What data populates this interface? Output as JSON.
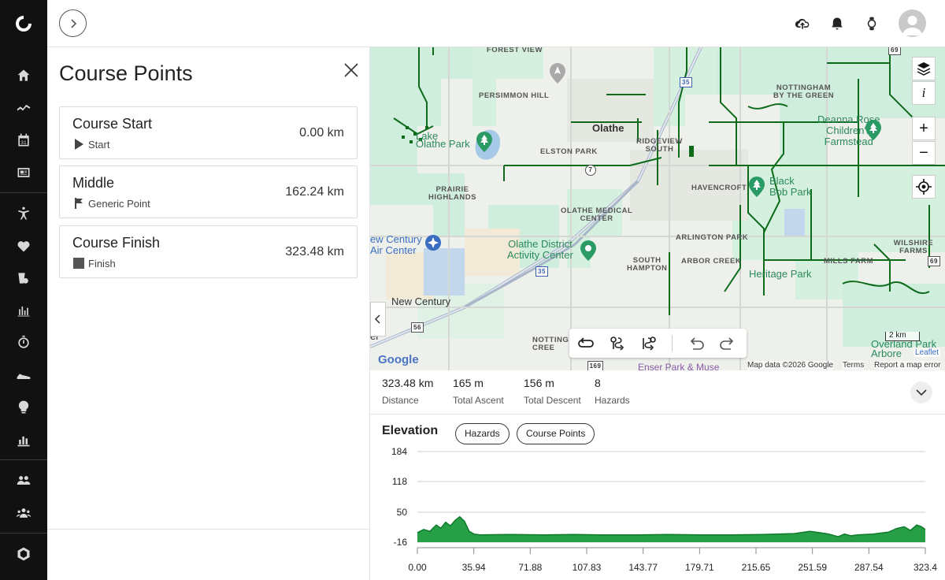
{
  "nav": {
    "items": [
      "home-icon",
      "activity-icon",
      "calendar-icon",
      "news-icon",
      "fitness-icon",
      "heart-icon",
      "nutrition-icon",
      "stats-icon",
      "stopwatch-icon",
      "shoe-icon",
      "insights-icon",
      "reports-icon",
      "connections-icon",
      "groups-icon",
      "badge-icon"
    ],
    "calendar_day": "31"
  },
  "panel": {
    "title": "Course Points",
    "points": [
      {
        "name": "Course Start",
        "type": "Start",
        "distance": "0.00 km"
      },
      {
        "name": "Middle",
        "type": "Generic Point",
        "distance": "162.24 km"
      },
      {
        "name": "Course Finish",
        "type": "Finish",
        "distance": "323.48 km"
      }
    ]
  },
  "map": {
    "labels": {
      "forest_view": "FOREST VIEW",
      "persimmon_hill": "PERSIMMON HILL",
      "nottingham": "NOTTINGHAM\nBY THE GREEN",
      "olathe": "Olathe",
      "lake_olathe": "Lake\nOlathe Park",
      "elston_park": "ELSTON PARK",
      "ridgeview_south": "RIDGEVIEW\nSOUTH",
      "deanna_rose": "Deanna Rose\nChildren's\nFarmstead",
      "prairie_highlands": "PRAIRIE\nHIGHLANDS",
      "havencroft": "HAVENCROFT",
      "black_bob": "Black\nBob Park",
      "olathe_medical": "OLATHE MEDICAL\nCENTER",
      "new_century_air": "ew Century\nAir Center",
      "olathe_district": "Olathe District\nActivity Center",
      "arlington_park": "ARLINGTON PARK",
      "wilshire_farms": "WILSHIRE FARMS",
      "south_hampton": "SOUTH\nHAMPTON",
      "arbor_creek": "ARBOR CREEK",
      "mills_farm": "MILLS FARM",
      "heritage_park": "Heritage Park",
      "new_century": "New Century",
      "nottingham_creek": "NOTTING\nCREE",
      "overland_park": "Overland Park\nArbore",
      "er": "er",
      "enser_park": "Enser Park & Muse",
      "hwy_35a": "35",
      "hwy_35b": "35",
      "hwy_7": "7",
      "hwy_56": "56",
      "hwy_169": "169",
      "hwy_69a": "69",
      "hwy_69b": "69"
    },
    "scale": "2 km",
    "leaflet": "Leaflet",
    "google": "Google",
    "attribution": {
      "data": "Map data ©2026 Google",
      "terms": "Terms",
      "report": "Report a map error"
    },
    "controls": {
      "zoom_in": "+",
      "zoom_out": "−",
      "info": "i"
    }
  },
  "stats": [
    {
      "value": "323.48 km",
      "label": "Distance"
    },
    {
      "value": "165 m",
      "label": "Total Ascent"
    },
    {
      "value": "156 m",
      "label": "Total Descent"
    },
    {
      "value": "8",
      "label": "Hazards"
    }
  ],
  "elevation": {
    "title": "Elevation",
    "buttons": {
      "hazards": "Hazards",
      "course_points": "Course Points"
    }
  },
  "chart_data": {
    "type": "area",
    "title": "Elevation",
    "xlabel": "",
    "ylabel": "",
    "yticks": [
      "184",
      "118",
      "50",
      "-16"
    ],
    "xticks": [
      "0.00",
      "35.94",
      "71.88",
      "107.83",
      "143.77",
      "179.71",
      "215.65",
      "251.59",
      "287.54",
      "323.4"
    ],
    "xlim": [
      0,
      323.48
    ],
    "ylim": [
      -16,
      184
    ],
    "color": "#1a9a3c",
    "x": [
      0,
      4,
      8,
      12,
      15,
      18,
      21,
      24,
      27,
      30,
      33,
      36,
      40,
      60,
      80,
      100,
      120,
      140,
      160,
      180,
      200,
      220,
      240,
      250,
      256,
      262,
      268,
      272,
      276,
      280,
      290,
      300,
      305,
      310,
      314,
      318,
      321,
      323.48
    ],
    "y": [
      5,
      12,
      8,
      22,
      15,
      28,
      20,
      32,
      40,
      30,
      8,
      2,
      0,
      1,
      0,
      1,
      0,
      0,
      1,
      0,
      0,
      1,
      3,
      8,
      5,
      2,
      -4,
      2,
      -2,
      0,
      2,
      6,
      14,
      18,
      10,
      22,
      18,
      12
    ]
  }
}
